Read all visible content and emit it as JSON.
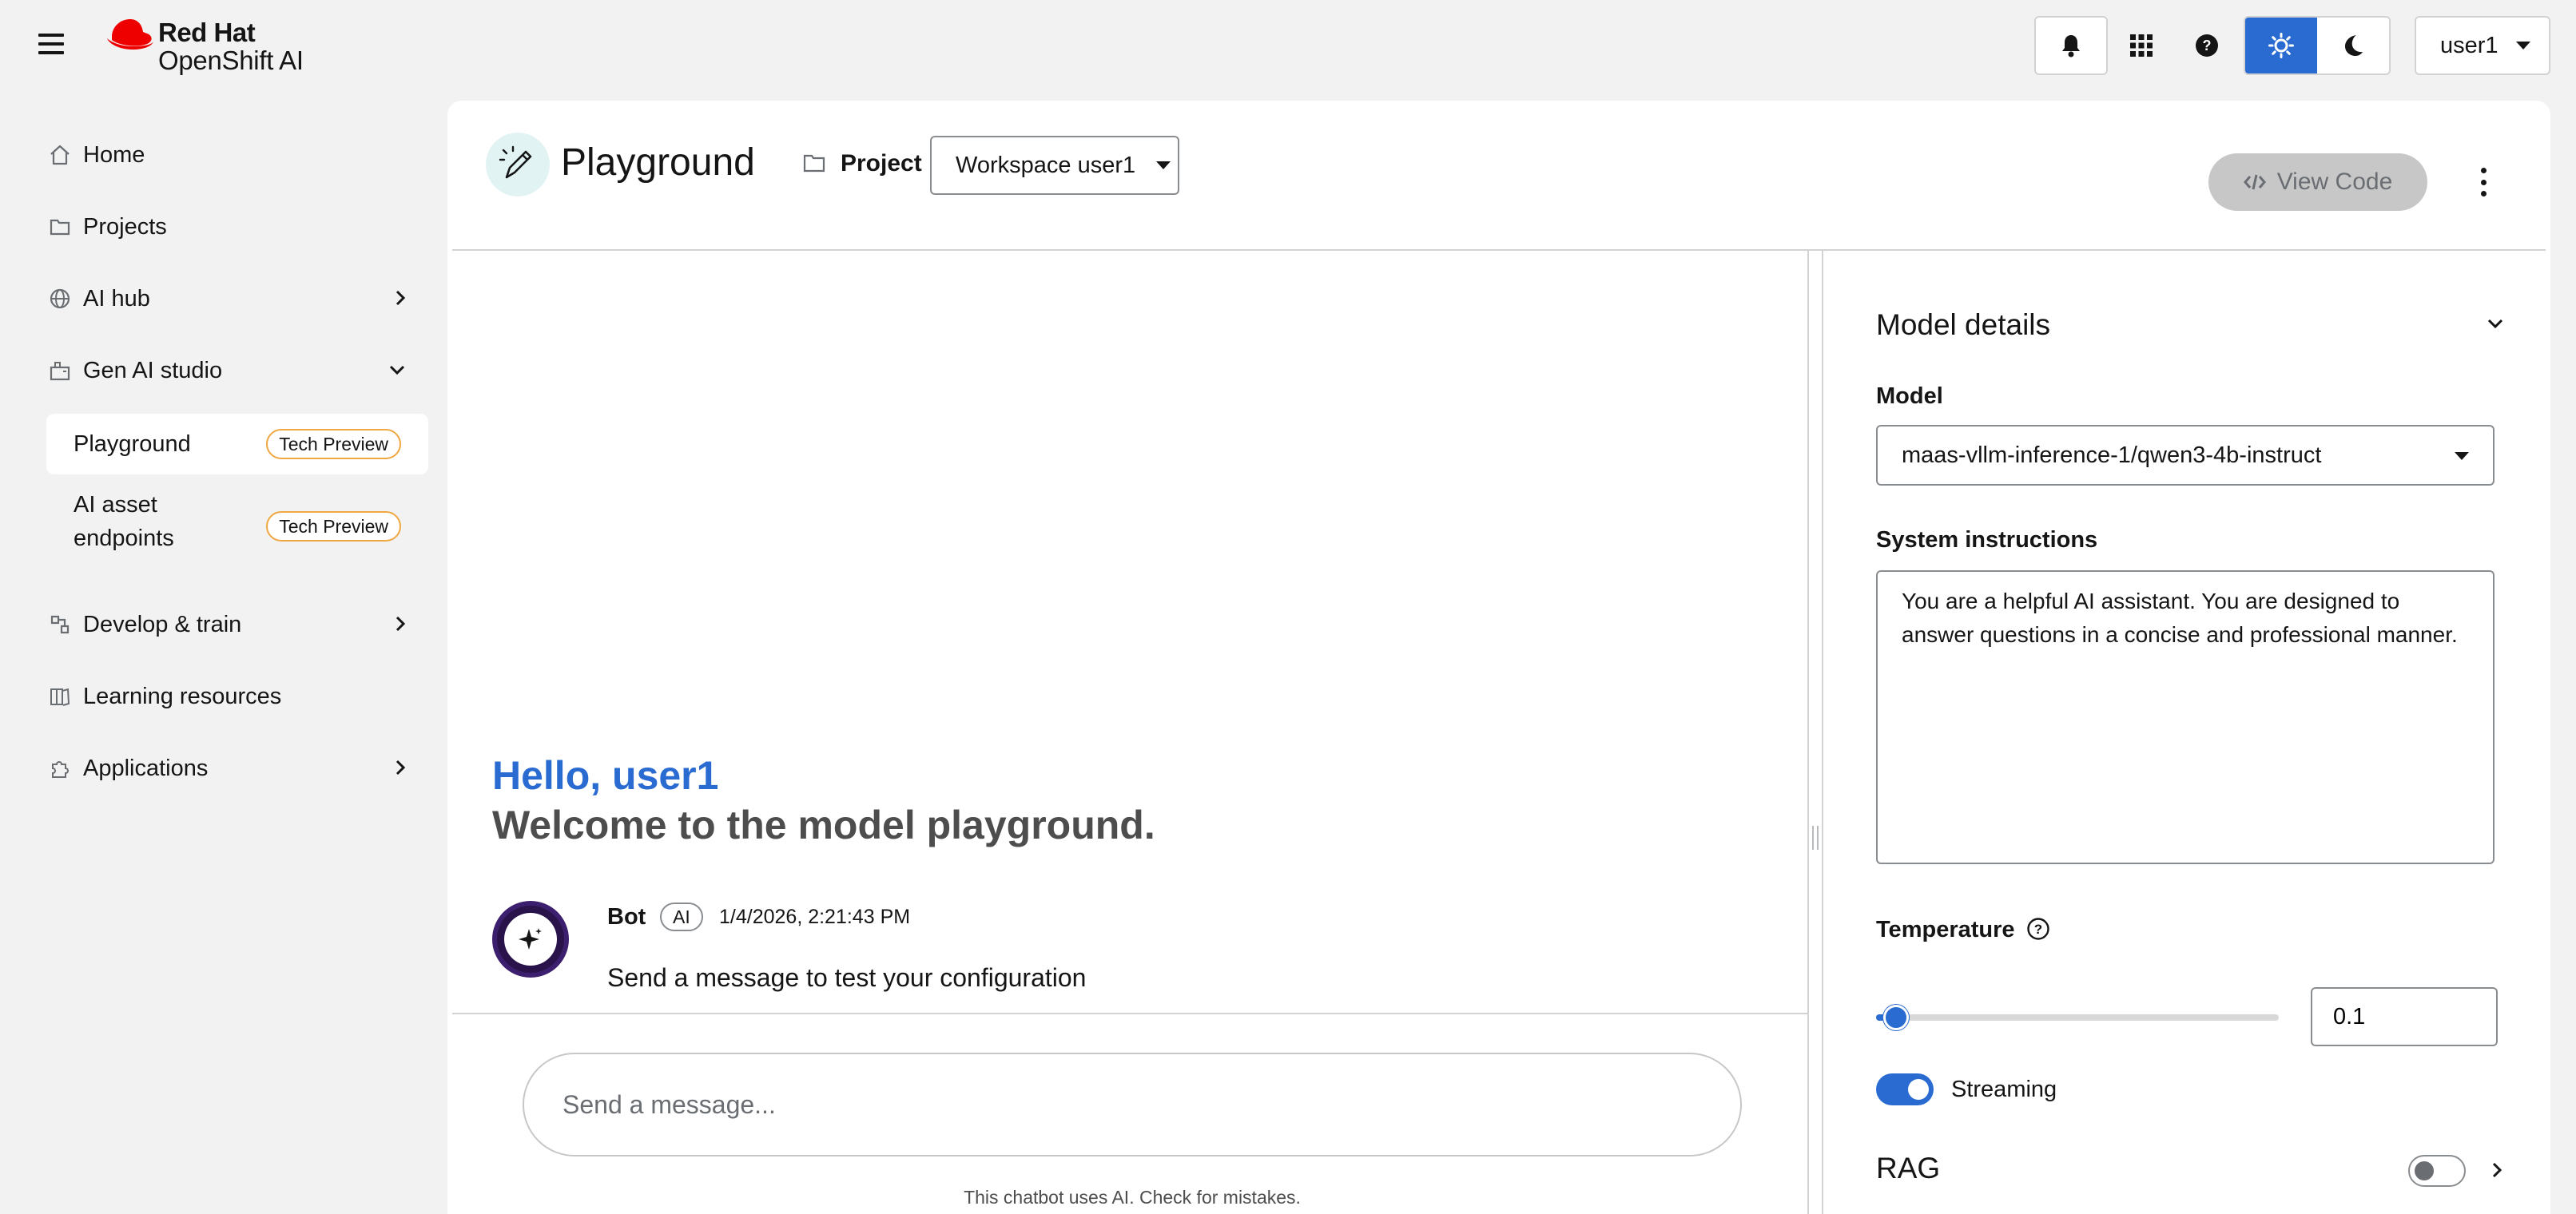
{
  "masthead": {
    "brand_line1": "Red Hat",
    "brand_line2": "OpenShift AI",
    "user_label": "user1",
    "icons": [
      "menu-icon",
      "bell-icon",
      "app-grid-icon",
      "help-icon",
      "sun-icon",
      "moon-icon"
    ],
    "accent_color": "#2a6bd2",
    "brand_color": "#ee0000"
  },
  "sidebar": {
    "items": [
      {
        "label": "Home",
        "icon": "home-icon"
      },
      {
        "label": "Projects",
        "icon": "folder-icon"
      },
      {
        "label": "AI hub",
        "icon": "globe-icon",
        "expandable": true
      },
      {
        "label": "Gen AI studio",
        "icon": "studio-icon",
        "expanded": true
      },
      {
        "label": "Develop & train",
        "icon": "develop-icon",
        "expandable": true
      },
      {
        "label": "Learning resources",
        "icon": "book-icon"
      },
      {
        "label": "Applications",
        "icon": "puzzle-icon",
        "expandable": true
      }
    ],
    "sub_items": [
      {
        "label": "Playground",
        "tag": "Tech Preview",
        "active": true
      },
      {
        "label_line1": "AI asset",
        "label_line2": "endpoints",
        "tag": "Tech Preview"
      }
    ]
  },
  "page": {
    "title": "Playground",
    "project_label": "Project",
    "project_value": "Workspace user1",
    "view_code_label": "View Code"
  },
  "chat": {
    "hello": "Hello, user1",
    "welcome": "Welcome to the model playground.",
    "bot_name": "Bot",
    "bot_badge": "AI",
    "bot_time": "1/4/2026, 2:21:43 PM",
    "bot_message": "Send a message to test your configuration",
    "input_placeholder": "Send a message...",
    "disclaimer": "This chatbot uses AI. Check for mistakes."
  },
  "panel": {
    "title": "Model details",
    "model_label": "Model",
    "model_value": "maas-vllm-inference-1/qwen3-4b-instruct",
    "system_label": "System instructions",
    "system_value": "You are a helpful AI assistant. You are designed to answer questions in a concise and professional manner.",
    "temperature_label": "Temperature",
    "temperature_value": "0.1",
    "temperature_fraction": 0.05,
    "streaming_label": "Streaming",
    "streaming_on": true,
    "rag_label": "RAG",
    "rag_on": false
  }
}
